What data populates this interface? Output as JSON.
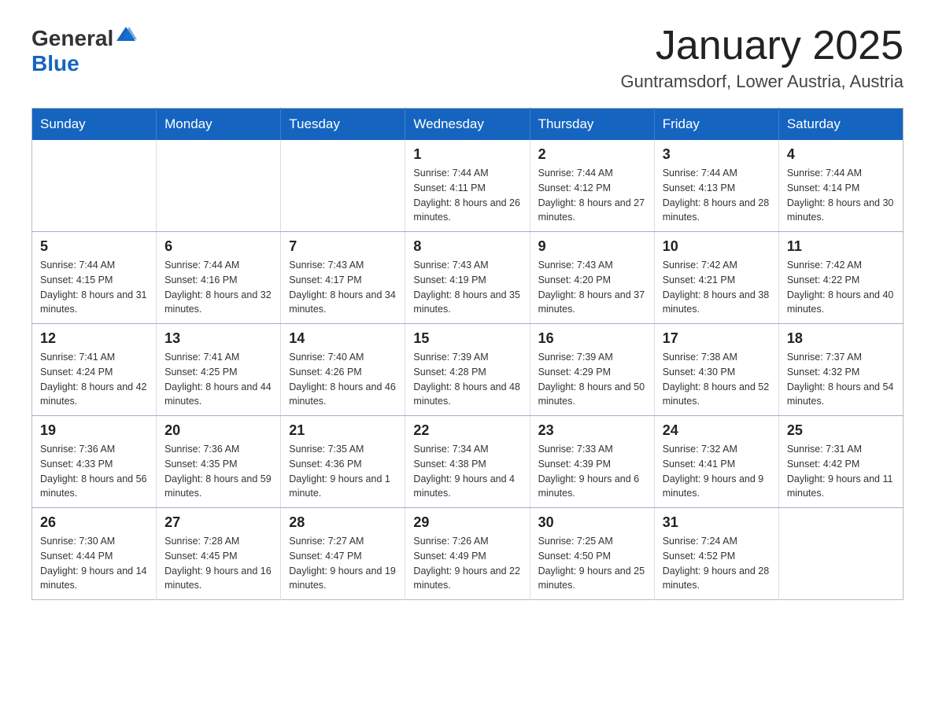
{
  "header": {
    "logo_general": "General",
    "logo_blue": "Blue",
    "month_year": "January 2025",
    "location": "Guntramsdorf, Lower Austria, Austria"
  },
  "days_of_week": [
    "Sunday",
    "Monday",
    "Tuesday",
    "Wednesday",
    "Thursday",
    "Friday",
    "Saturday"
  ],
  "weeks": [
    [
      {
        "day": "",
        "info": ""
      },
      {
        "day": "",
        "info": ""
      },
      {
        "day": "",
        "info": ""
      },
      {
        "day": "1",
        "info": "Sunrise: 7:44 AM\nSunset: 4:11 PM\nDaylight: 8 hours\nand 26 minutes."
      },
      {
        "day": "2",
        "info": "Sunrise: 7:44 AM\nSunset: 4:12 PM\nDaylight: 8 hours\nand 27 minutes."
      },
      {
        "day": "3",
        "info": "Sunrise: 7:44 AM\nSunset: 4:13 PM\nDaylight: 8 hours\nand 28 minutes."
      },
      {
        "day": "4",
        "info": "Sunrise: 7:44 AM\nSunset: 4:14 PM\nDaylight: 8 hours\nand 30 minutes."
      }
    ],
    [
      {
        "day": "5",
        "info": "Sunrise: 7:44 AM\nSunset: 4:15 PM\nDaylight: 8 hours\nand 31 minutes."
      },
      {
        "day": "6",
        "info": "Sunrise: 7:44 AM\nSunset: 4:16 PM\nDaylight: 8 hours\nand 32 minutes."
      },
      {
        "day": "7",
        "info": "Sunrise: 7:43 AM\nSunset: 4:17 PM\nDaylight: 8 hours\nand 34 minutes."
      },
      {
        "day": "8",
        "info": "Sunrise: 7:43 AM\nSunset: 4:19 PM\nDaylight: 8 hours\nand 35 minutes."
      },
      {
        "day": "9",
        "info": "Sunrise: 7:43 AM\nSunset: 4:20 PM\nDaylight: 8 hours\nand 37 minutes."
      },
      {
        "day": "10",
        "info": "Sunrise: 7:42 AM\nSunset: 4:21 PM\nDaylight: 8 hours\nand 38 minutes."
      },
      {
        "day": "11",
        "info": "Sunrise: 7:42 AM\nSunset: 4:22 PM\nDaylight: 8 hours\nand 40 minutes."
      }
    ],
    [
      {
        "day": "12",
        "info": "Sunrise: 7:41 AM\nSunset: 4:24 PM\nDaylight: 8 hours\nand 42 minutes."
      },
      {
        "day": "13",
        "info": "Sunrise: 7:41 AM\nSunset: 4:25 PM\nDaylight: 8 hours\nand 44 minutes."
      },
      {
        "day": "14",
        "info": "Sunrise: 7:40 AM\nSunset: 4:26 PM\nDaylight: 8 hours\nand 46 minutes."
      },
      {
        "day": "15",
        "info": "Sunrise: 7:39 AM\nSunset: 4:28 PM\nDaylight: 8 hours\nand 48 minutes."
      },
      {
        "day": "16",
        "info": "Sunrise: 7:39 AM\nSunset: 4:29 PM\nDaylight: 8 hours\nand 50 minutes."
      },
      {
        "day": "17",
        "info": "Sunrise: 7:38 AM\nSunset: 4:30 PM\nDaylight: 8 hours\nand 52 minutes."
      },
      {
        "day": "18",
        "info": "Sunrise: 7:37 AM\nSunset: 4:32 PM\nDaylight: 8 hours\nand 54 minutes."
      }
    ],
    [
      {
        "day": "19",
        "info": "Sunrise: 7:36 AM\nSunset: 4:33 PM\nDaylight: 8 hours\nand 56 minutes."
      },
      {
        "day": "20",
        "info": "Sunrise: 7:36 AM\nSunset: 4:35 PM\nDaylight: 8 hours\nand 59 minutes."
      },
      {
        "day": "21",
        "info": "Sunrise: 7:35 AM\nSunset: 4:36 PM\nDaylight: 9 hours\nand 1 minute."
      },
      {
        "day": "22",
        "info": "Sunrise: 7:34 AM\nSunset: 4:38 PM\nDaylight: 9 hours\nand 4 minutes."
      },
      {
        "day": "23",
        "info": "Sunrise: 7:33 AM\nSunset: 4:39 PM\nDaylight: 9 hours\nand 6 minutes."
      },
      {
        "day": "24",
        "info": "Sunrise: 7:32 AM\nSunset: 4:41 PM\nDaylight: 9 hours\nand 9 minutes."
      },
      {
        "day": "25",
        "info": "Sunrise: 7:31 AM\nSunset: 4:42 PM\nDaylight: 9 hours\nand 11 minutes."
      }
    ],
    [
      {
        "day": "26",
        "info": "Sunrise: 7:30 AM\nSunset: 4:44 PM\nDaylight: 9 hours\nand 14 minutes."
      },
      {
        "day": "27",
        "info": "Sunrise: 7:28 AM\nSunset: 4:45 PM\nDaylight: 9 hours\nand 16 minutes."
      },
      {
        "day": "28",
        "info": "Sunrise: 7:27 AM\nSunset: 4:47 PM\nDaylight: 9 hours\nand 19 minutes."
      },
      {
        "day": "29",
        "info": "Sunrise: 7:26 AM\nSunset: 4:49 PM\nDaylight: 9 hours\nand 22 minutes."
      },
      {
        "day": "30",
        "info": "Sunrise: 7:25 AM\nSunset: 4:50 PM\nDaylight: 9 hours\nand 25 minutes."
      },
      {
        "day": "31",
        "info": "Sunrise: 7:24 AM\nSunset: 4:52 PM\nDaylight: 9 hours\nand 28 minutes."
      },
      {
        "day": "",
        "info": ""
      }
    ]
  ]
}
